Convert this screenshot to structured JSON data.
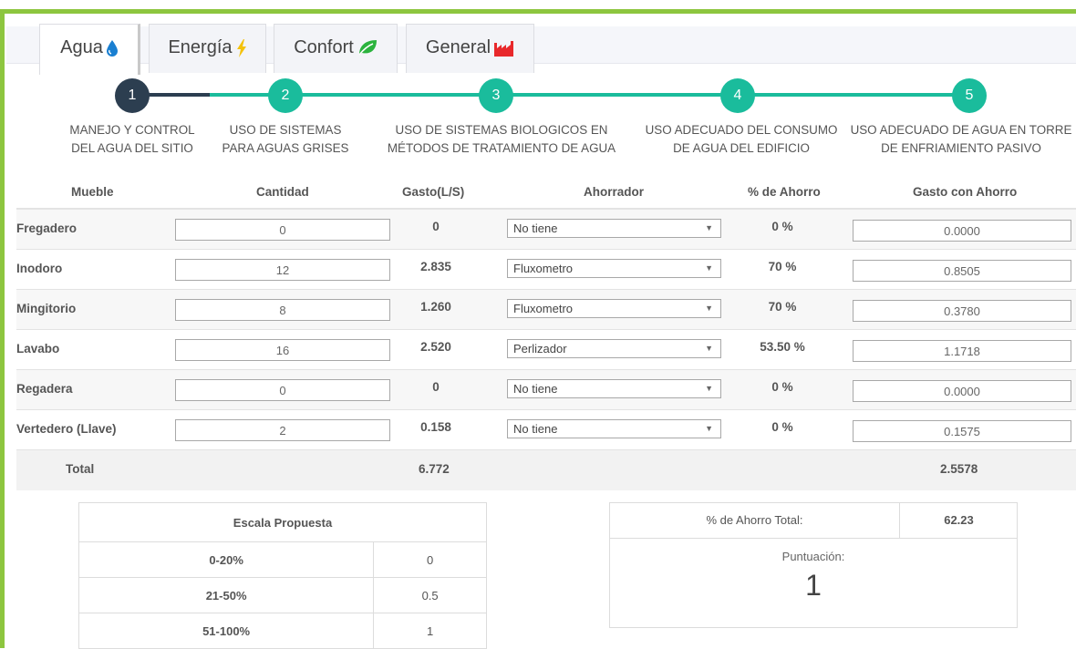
{
  "tabs": [
    {
      "label": "Agua",
      "icon": "water-drop-icon",
      "color": "#1a7fd1",
      "active": true
    },
    {
      "label": "Energía",
      "icon": "lightning-icon",
      "color": "#f4c20d",
      "active": false
    },
    {
      "label": "Confort",
      "icon": "leaf-icon",
      "color": "#2bb33e",
      "active": false
    },
    {
      "label": "General",
      "icon": "factory-icon",
      "color": "#e8282b",
      "active": false
    }
  ],
  "steps": [
    {
      "number": "1",
      "line1": "MANEJO Y CONTROL",
      "line2": "DEL AGUA DEL SITIO",
      "state": "current"
    },
    {
      "number": "2",
      "line1": "USO DE SISTEMAS",
      "line2": "PARA AGUAS GRISES",
      "state": "upcoming"
    },
    {
      "number": "3",
      "line1": "USO DE SISTEMAS BIOLOGICOS EN",
      "line2": "MÉTODOS DE TRATAMIENTO DE AGUA",
      "state": "upcoming"
    },
    {
      "number": "4",
      "line1": "USO ADECUADO DEL CONSUMO",
      "line2": "DE AGUA DEL EDIFICIO",
      "state": "upcoming"
    },
    {
      "number": "5",
      "line1": "USO ADECUADO DE AGUA EN TORRE",
      "line2": "DE ENFRIAMIENTO PASIVO",
      "state": "upcoming"
    }
  ],
  "colors": {
    "accent": "#8dc63f",
    "step_active": "#2c3e50",
    "step_teal": "#1abc9c"
  },
  "table": {
    "headers": {
      "mueble": "Mueble",
      "cantidad": "Cantidad",
      "gasto": "Gasto(L/S)",
      "ahorrador": "Ahorrador",
      "pct": "% de Ahorro",
      "gasto_ahorro": "Gasto con Ahorro"
    },
    "rows": [
      {
        "mueble": "Fregadero",
        "cantidad": "0",
        "gasto": "0",
        "ahorrador": "No tiene",
        "pct": "0 %",
        "gasto_ahorro": "0.0000"
      },
      {
        "mueble": "Inodoro",
        "cantidad": "12",
        "gasto": "2.835",
        "ahorrador": "Fluxometro",
        "pct": "70 %",
        "gasto_ahorro": "0.8505"
      },
      {
        "mueble": "Mingitorio",
        "cantidad": "8",
        "gasto": "1.260",
        "ahorrador": "Fluxometro",
        "pct": "70 %",
        "gasto_ahorro": "0.3780"
      },
      {
        "mueble": "Lavabo",
        "cantidad": "16",
        "gasto": "2.520",
        "ahorrador": "Perlizador",
        "pct": "53.50 %",
        "gasto_ahorro": "1.1718"
      },
      {
        "mueble": "Regadera",
        "cantidad": "0",
        "gasto": "0",
        "ahorrador": "No tiene",
        "pct": "0 %",
        "gasto_ahorro": "0.0000"
      },
      {
        "mueble": "Vertedero (Llave)",
        "cantidad": "2",
        "gasto": "0.158",
        "ahorrador": "No tiene",
        "pct": "0 %",
        "gasto_ahorro": "0.1575"
      }
    ],
    "total": {
      "label": "Total",
      "gasto": "6.772",
      "gasto_ahorro": "2.5578"
    }
  },
  "escala": {
    "title": "Escala Propuesta",
    "rows": [
      {
        "range": "0-20%",
        "value": "0"
      },
      {
        "range": "21-50%",
        "value": "0.5"
      },
      {
        "range": "51-100%",
        "value": "1"
      }
    ]
  },
  "ahorro": {
    "label": "% de Ahorro Total:",
    "value": "62.23",
    "puntuacion_label": "Puntuación:",
    "puntuacion_value": "1"
  }
}
